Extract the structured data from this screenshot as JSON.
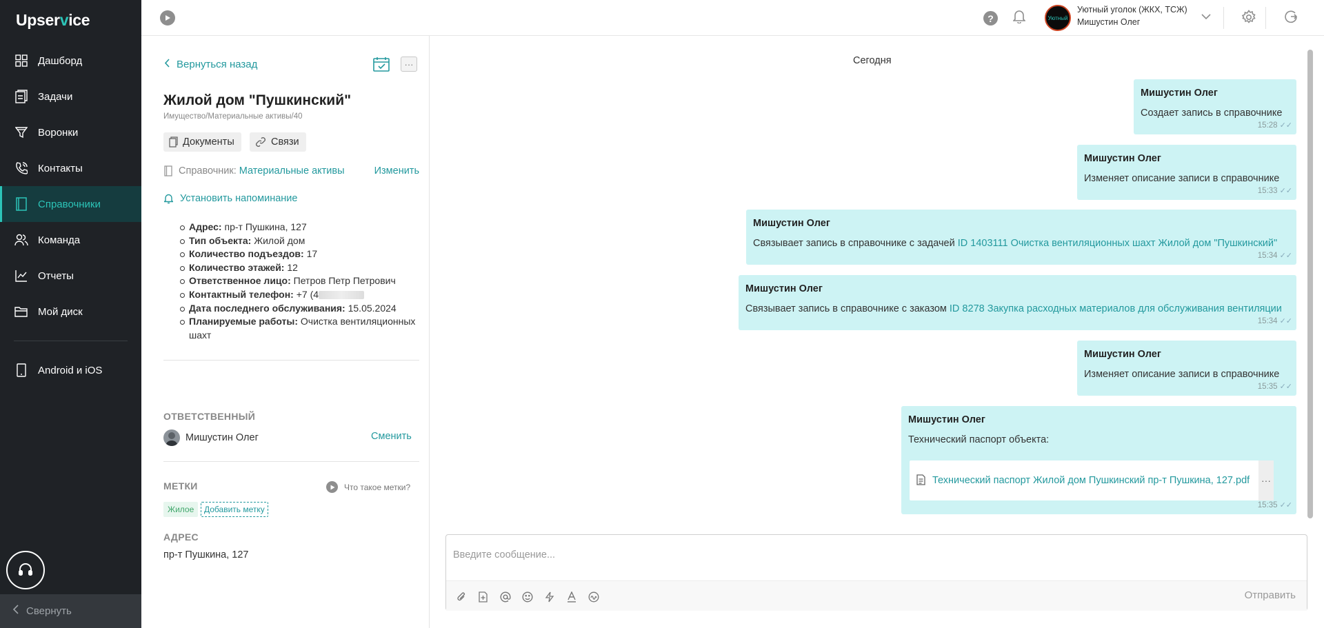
{
  "app": {
    "logo_pre": "Upser",
    "logo_accent": "v",
    "logo_post": "ice"
  },
  "sidebar": {
    "items": [
      {
        "label": "Дашборд",
        "icon": "grid-icon"
      },
      {
        "label": "Задачи",
        "icon": "tasks-icon"
      },
      {
        "label": "Воронки",
        "icon": "funnel-icon"
      },
      {
        "label": "Контакты",
        "icon": "phone-icon"
      },
      {
        "label": "Справочники",
        "icon": "book-icon"
      },
      {
        "label": "Команда",
        "icon": "team-icon"
      },
      {
        "label": "Отчеты",
        "icon": "chart-icon"
      },
      {
        "label": "Мой диск",
        "icon": "folder-icon"
      }
    ],
    "mobile_label": "Android и iOS",
    "collapse_label": "Свернуть"
  },
  "header": {
    "org_name": "Уютный уголок (ЖКХ, ТСЖ)",
    "user_name": "Мишустин Олег",
    "avatar_text": "Уютный"
  },
  "details": {
    "back_label": "Вернуться назад",
    "more_label": "···",
    "title": "Жилой дом \"Пушкинский\"",
    "subtitle": "Имущество/Материальные активы/40",
    "documents_label": "Документы",
    "links_label": "Связи",
    "ref_prefix": "Справочник:",
    "ref_value": "Материальные активы",
    "ref_change": "Изменить",
    "reminder_label": "Установить напоминание",
    "properties": [
      {
        "key": "Адрес:",
        "value": "пр-т Пушкина, 127"
      },
      {
        "key": "Тип объекта:",
        "value": "Жилой дом"
      },
      {
        "key": "Количество подъездов:",
        "value": "17"
      },
      {
        "key": "Количество этажей:",
        "value": "12"
      },
      {
        "key": "Ответственное лицо:",
        "value": "Петров Петр Петрович"
      },
      {
        "key": "Контактный телефон:",
        "value": "+7 (4"
      },
      {
        "key": "Дата последнего обслуживания:",
        "value": "15.05.2024"
      },
      {
        "key": "Планируемые работы:",
        "value": "Очистка вентиляционных шахт"
      }
    ],
    "responsible_title": "ОТВЕТСТВЕННЫЙ",
    "responsible_name": "Мишустин Олег",
    "responsible_change": "Сменить",
    "tags_title": "МЕТКИ",
    "tags_help": "Что такое метки?",
    "tags": [
      "Жилое"
    ],
    "add_tag_label": "Добавить метку",
    "address_title": "АДРЕС",
    "address_value": "пр-т Пушкина, 127"
  },
  "chat": {
    "day_label": "Сегодня",
    "messages": [
      {
        "author": "Мишустин Олег",
        "text": "Создает запись в справочнике",
        "link": "",
        "time": "15:28"
      },
      {
        "author": "Мишустин Олег",
        "text": "Изменяет описание записи в справочнике",
        "link": "",
        "time": "15:33"
      },
      {
        "author": "Мишустин Олег",
        "text": "Связывает запись в справочнике с задачей ",
        "link": "ID 1403111 Очистка вентиляционных шахт Жилой дом \"Пушкинский\"",
        "time": "15:34"
      },
      {
        "author": "Мишустин Олег",
        "text": "Связывает запись в справочнике с заказом ",
        "link": "ID 8278 Закупка расходных материалов для обслуживания вентиляции",
        "time": "15:34"
      },
      {
        "author": "Мишустин Олег",
        "text": "Изменяет описание записи в справочнике",
        "link": "",
        "time": "15:35"
      },
      {
        "author": "Мишустин Олег",
        "text": "Технический паспорт объекта:",
        "link": "",
        "time": "15:35",
        "file": "Технический паспорт Жилой дом Пушкинский пр-т Пушкина, 127.pdf"
      }
    ],
    "composer_placeholder": "Введите сообщение...",
    "send_label": "Отправить",
    "file_more": "···"
  },
  "colors": {
    "accent": "#23999e",
    "sidebar_bg": "#1f2226",
    "active_bg": "#153c3f",
    "bubble_bg": "#cdf3f4",
    "tag_bg": "#e7f6ee"
  }
}
